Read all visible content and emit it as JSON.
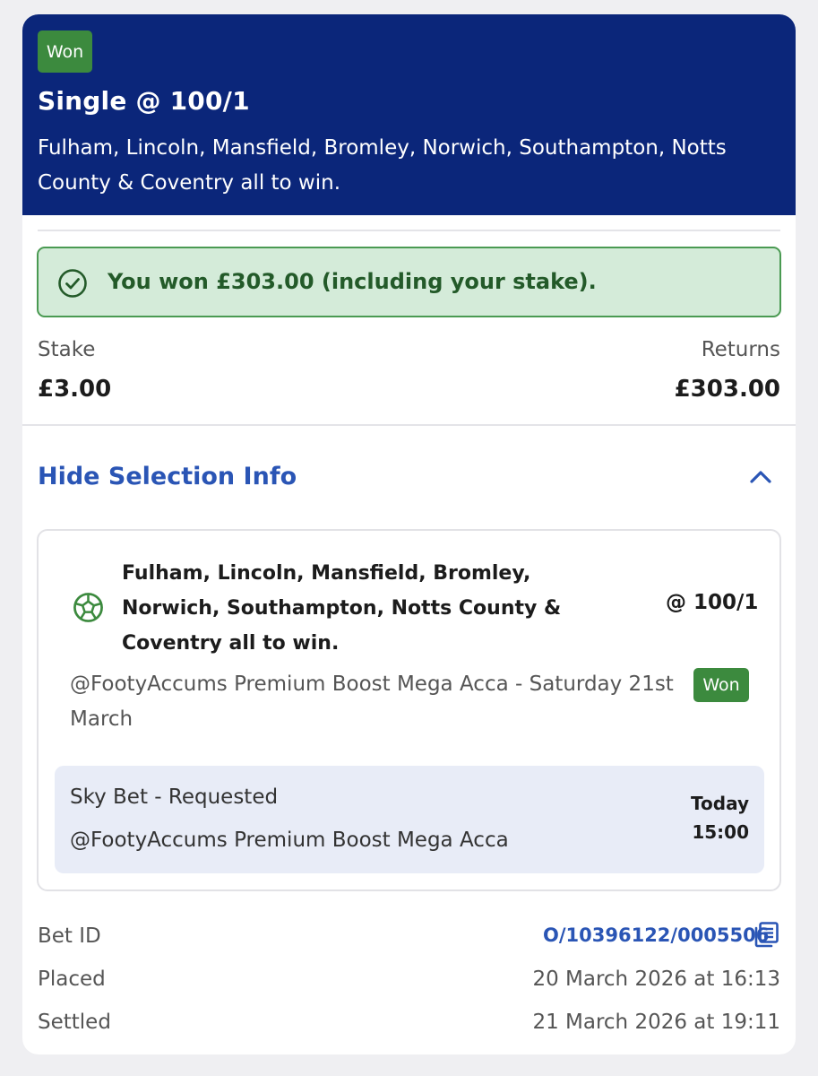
{
  "header": {
    "status_badge": "Won",
    "title": "Single @ 100/1",
    "description": "Fulham, Lincoln, Mansfield, Bromley, Norwich, Southampton, Notts County & Coventry all to win."
  },
  "result_banner": {
    "text": "You won £303.00 (including your stake)."
  },
  "summary": {
    "stake_label": "Stake",
    "stake_value": "£3.00",
    "returns_label": "Returns",
    "returns_value": "£303.00"
  },
  "selection_toggle": {
    "label": "Hide Selection Info"
  },
  "selection": {
    "icon": "football-icon",
    "title": "Fulham, Lincoln, Mansfield, Bromley, Norwich, Southampton, Notts County & Coventry all to win.",
    "odds": "@ 100/1",
    "market": "@FootyAccums Premium Boost Mega Acca - Saturday 21st March",
    "status_badge": "Won",
    "event": {
      "name": "Sky Bet - Requested",
      "subtitle": "@FootyAccums Premium Boost Mega Acca",
      "day": "Today",
      "time": "15:00"
    }
  },
  "meta": {
    "bet_id_label": "Bet ID",
    "bet_id_value": "O/10396122/0005506",
    "placed_label": "Placed",
    "placed_value": "20 March 2026 at 16:13",
    "settled_label": "Settled",
    "settled_value": "21 March 2026 at 19:11"
  },
  "colors": {
    "header_bg": "#0b267a",
    "won_green": "#3c8a3e",
    "banner_bg": "#d4ebd9",
    "link_blue": "#2a55b5"
  }
}
